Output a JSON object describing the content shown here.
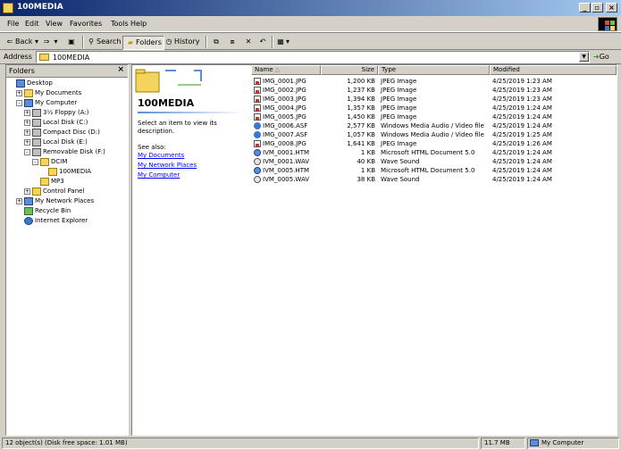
{
  "window": {
    "title": "100MEDIA"
  },
  "menu": [
    "File",
    "Edit",
    "View",
    "Favorites",
    "Tools",
    "Help"
  ],
  "toolbar": {
    "back": "Back",
    "search": "Search",
    "folders": "Folders",
    "history": "History"
  },
  "address": {
    "label": "Address",
    "value": "100MEDIA",
    "go": "Go"
  },
  "folders_pane": {
    "title": "Folders",
    "tree": [
      {
        "label": "Desktop",
        "depth": 0,
        "icon": "desktop-icon",
        "expander": ""
      },
      {
        "label": "My Documents",
        "depth": 1,
        "icon": "folder-icon",
        "expander": "+"
      },
      {
        "label": "My Computer",
        "depth": 1,
        "icon": "computer-icon",
        "expander": "-"
      },
      {
        "label": "3½ Floppy (A:)",
        "depth": 2,
        "icon": "floppy-icon",
        "expander": "+"
      },
      {
        "label": "Local Disk (C:)",
        "depth": 2,
        "icon": "drive-icon",
        "expander": "+"
      },
      {
        "label": "Compact Disc (D:)",
        "depth": 2,
        "icon": "cd-icon",
        "expander": "+"
      },
      {
        "label": "Local Disk (E:)",
        "depth": 2,
        "icon": "drive-icon",
        "expander": "+"
      },
      {
        "label": "Removable Disk (F:)",
        "depth": 2,
        "icon": "removable-drive-icon",
        "expander": "-"
      },
      {
        "label": "DCIM",
        "depth": 3,
        "icon": "folder-icon",
        "expander": "-"
      },
      {
        "label": "100MEDIA",
        "depth": 4,
        "icon": "folder-icon",
        "expander": ""
      },
      {
        "label": "MP3",
        "depth": 3,
        "icon": "folder-icon",
        "expander": ""
      },
      {
        "label": "Control Panel",
        "depth": 2,
        "icon": "control-panel-icon",
        "expander": "+"
      },
      {
        "label": "My Network Places",
        "depth": 1,
        "icon": "network-icon",
        "expander": "+"
      },
      {
        "label": "Recycle Bin",
        "depth": 1,
        "icon": "recycle-bin-icon",
        "expander": ""
      },
      {
        "label": "Internet Explorer",
        "depth": 1,
        "icon": "ie-icon",
        "expander": ""
      }
    ]
  },
  "webview": {
    "title": "100MEDIA",
    "description": "Select an item to view its description.",
    "see_also": "See also:",
    "links": [
      "My Documents",
      "My Network Places",
      "My Computer"
    ]
  },
  "columns": [
    "Name",
    "Size",
    "Type",
    "Modified"
  ],
  "files": [
    {
      "name": "IMG_0001.JPG",
      "size": "1,200 KB",
      "type": "JPEG Image",
      "modified": "4/25/2019 1:23 AM",
      "icon": "jpg"
    },
    {
      "name": "IMG_0002.JPG",
      "size": "1,237 KB",
      "type": "JPEG Image",
      "modified": "4/25/2019 1:23 AM",
      "icon": "jpg"
    },
    {
      "name": "IMG_0003.JPG",
      "size": "1,394 KB",
      "type": "JPEG Image",
      "modified": "4/25/2019 1:23 AM",
      "icon": "jpg"
    },
    {
      "name": "IMG_0004.JPG",
      "size": "1,357 KB",
      "type": "JPEG Image",
      "modified": "4/25/2019 1:24 AM",
      "icon": "jpg"
    },
    {
      "name": "IMG_0005.JPG",
      "size": "1,450 KB",
      "type": "JPEG Image",
      "modified": "4/25/2019 1:24 AM",
      "icon": "jpg"
    },
    {
      "name": "IMG_0006.ASF",
      "size": "2,577 KB",
      "type": "Windows Media Audio / Video file",
      "modified": "4/25/2019 1:24 AM",
      "icon": "asf"
    },
    {
      "name": "IMG_0007.ASF",
      "size": "1,057 KB",
      "type": "Windows Media Audio / Video file",
      "modified": "4/25/2019 1:25 AM",
      "icon": "asf"
    },
    {
      "name": "IMG_0008.JPG",
      "size": "1,641 KB",
      "type": "JPEG Image",
      "modified": "4/25/2019 1:26 AM",
      "icon": "jpg"
    },
    {
      "name": "IVM_0001.HTM",
      "size": "1 KB",
      "type": "Microsoft HTML Document 5.0",
      "modified": "4/25/2019 1:24 AM",
      "icon": "htm"
    },
    {
      "name": "IVM_0001.WAV",
      "size": "40 KB",
      "type": "Wave Sound",
      "modified": "4/25/2019 1:24 AM",
      "icon": "wav"
    },
    {
      "name": "IVM_0005.HTM",
      "size": "1 KB",
      "type": "Microsoft HTML Document 5.0",
      "modified": "4/25/2019 1:24 AM",
      "icon": "htm"
    },
    {
      "name": "IVM_0005.WAV",
      "size": "38 KB",
      "type": "Wave Sound",
      "modified": "4/25/2019 1:24 AM",
      "icon": "wav"
    }
  ],
  "status": {
    "objects": "12 object(s) (Disk free space: 1.01 MB)",
    "size": "11.7 MB",
    "zone": "My Computer"
  }
}
